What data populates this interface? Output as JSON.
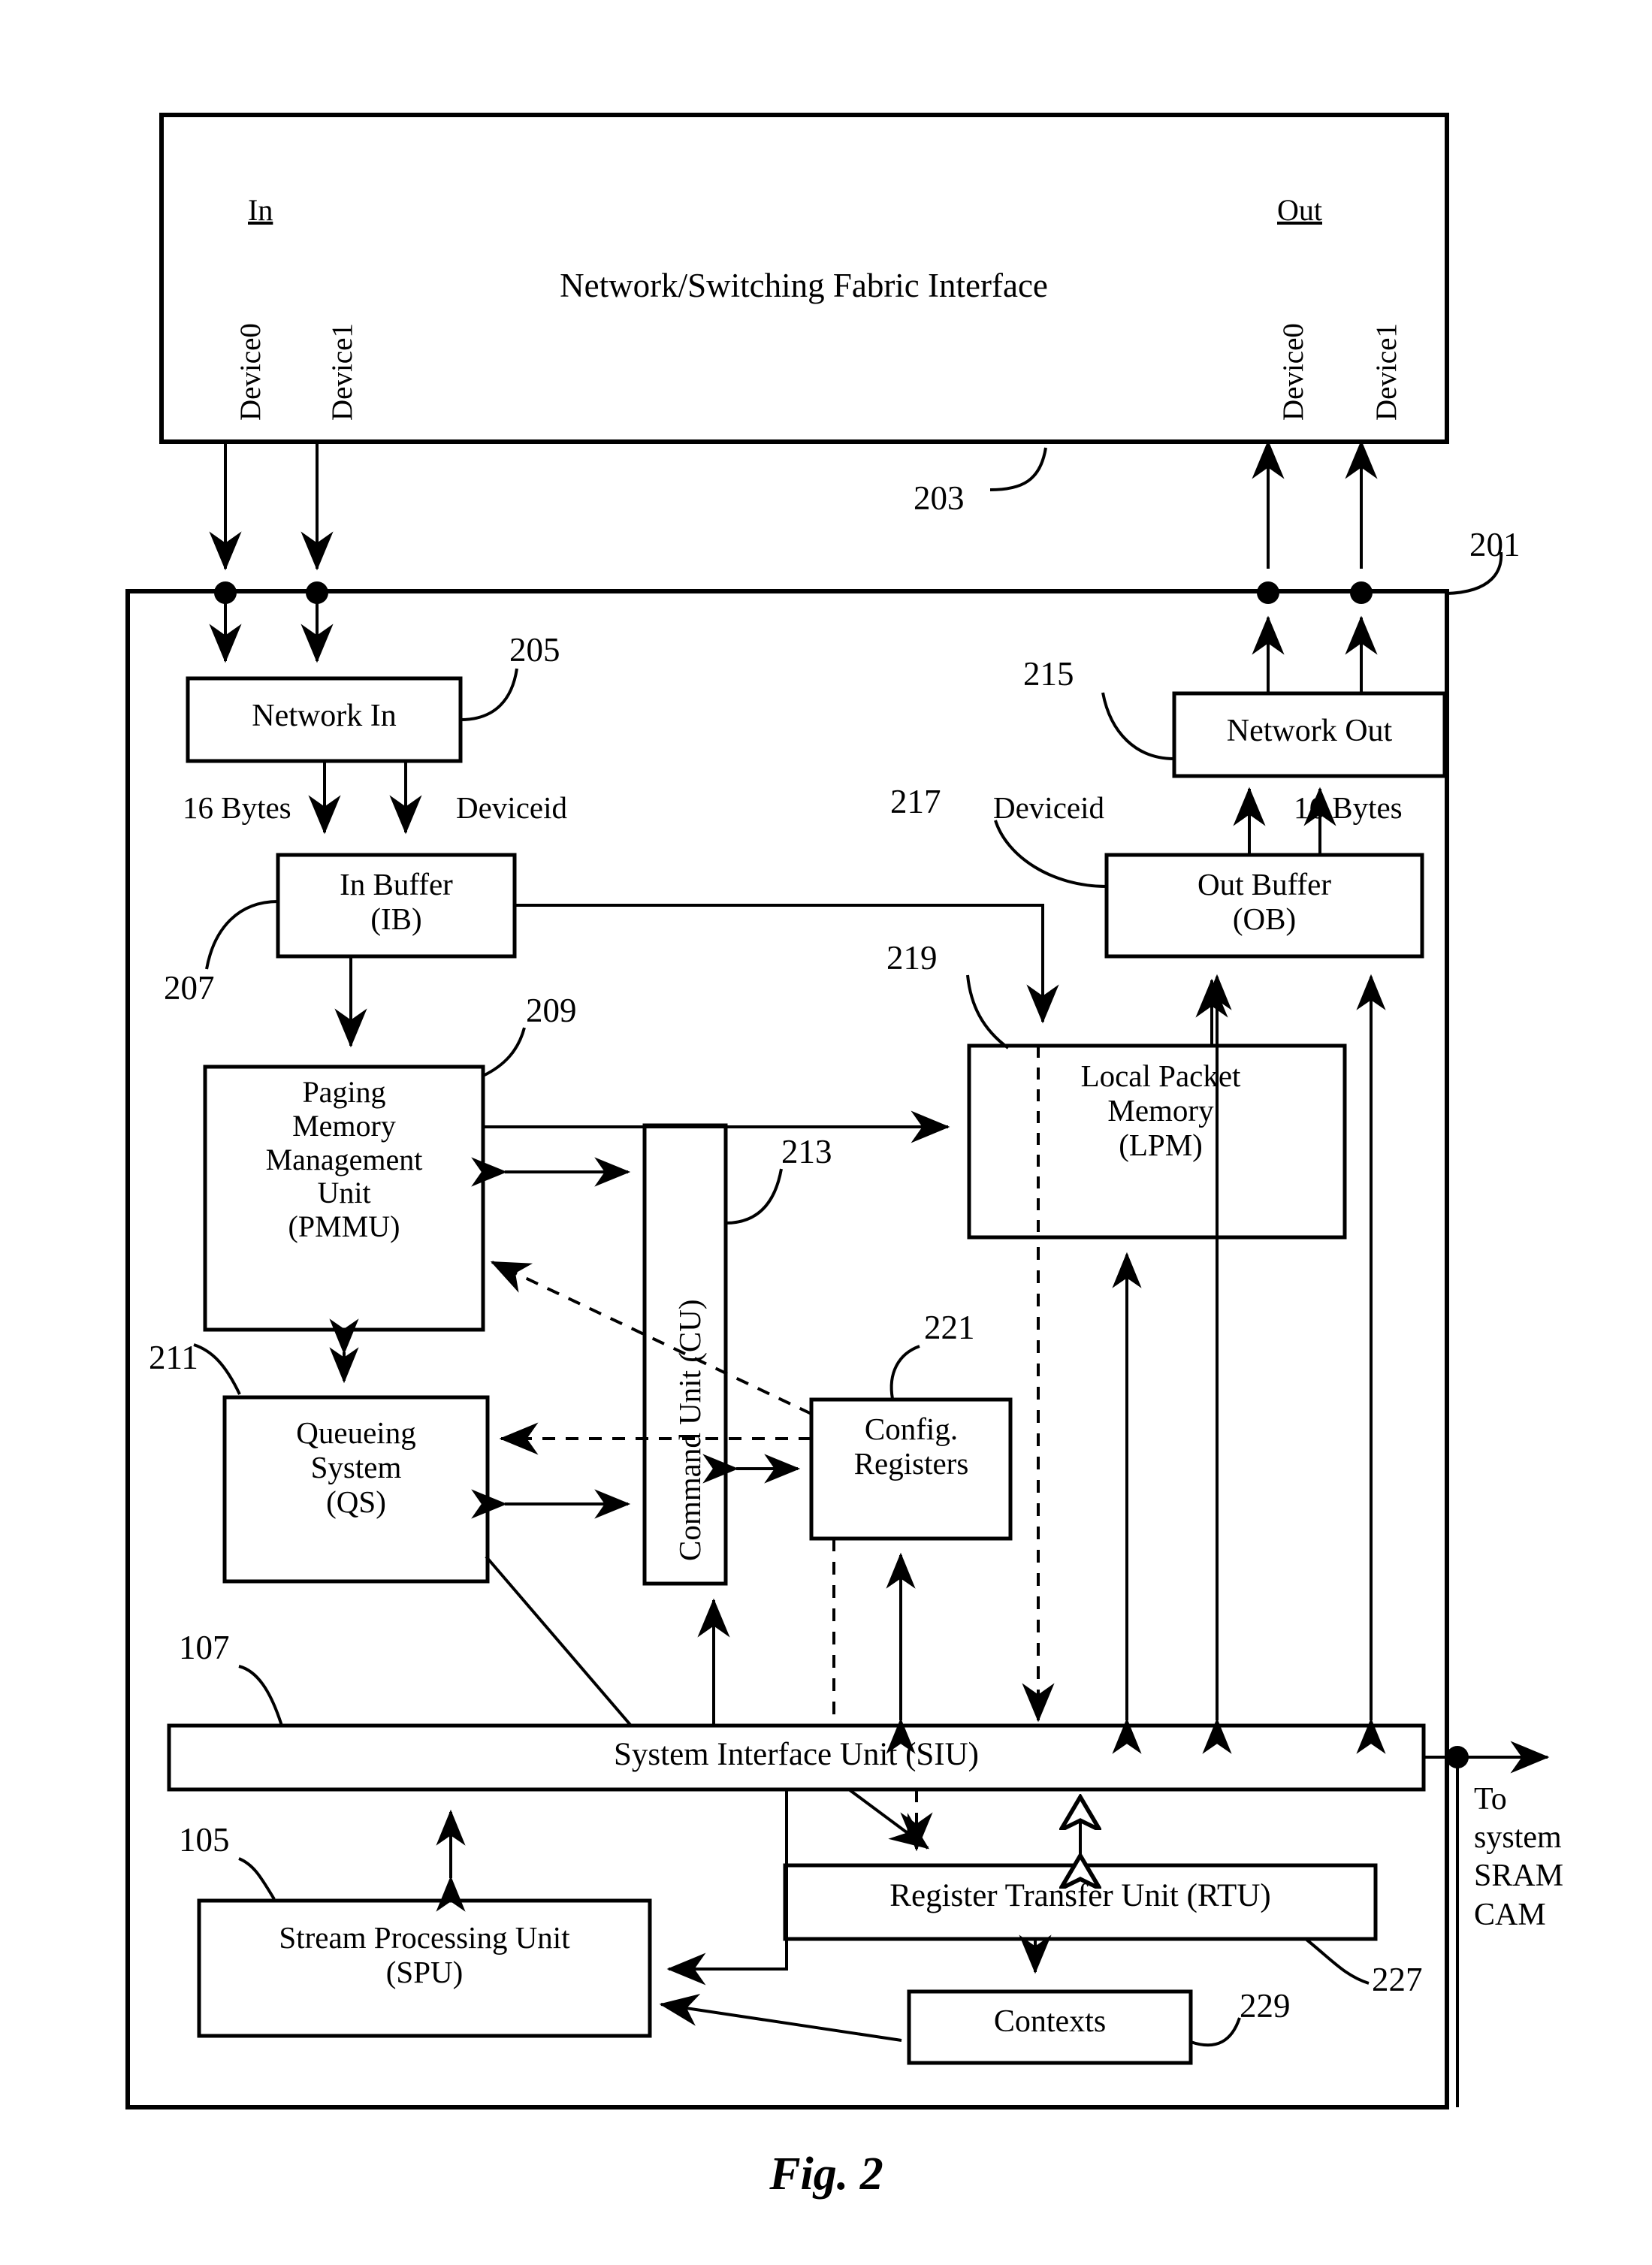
{
  "figure": {
    "caption": "Fig. 2",
    "outer_interface_box": {
      "title": "Network/Switching Fabric Interface",
      "in_group_label": "In",
      "out_group_label": "Out",
      "in_ports": [
        "Device0",
        "Device1"
      ],
      "out_ports": [
        "Device0",
        "Device1"
      ],
      "reference": "203"
    },
    "chip_box": {
      "reference": "201"
    },
    "blocks": [
      {
        "id": "network_in",
        "label": "Network In",
        "reference": "205"
      },
      {
        "id": "in_buffer",
        "label": "In Buffer\n(IB)",
        "reference": "207"
      },
      {
        "id": "pmmu",
        "label": "Paging\nMemory\nManagement\nUnit\n(PMMU)",
        "reference": "209"
      },
      {
        "id": "qs",
        "label": "Queueing\nSystem\n(QS)",
        "reference": "211"
      },
      {
        "id": "cu",
        "label": "Command Unit (CU)",
        "reference": "213"
      },
      {
        "id": "network_out",
        "label": "Network Out",
        "reference": "215"
      },
      {
        "id": "out_buffer",
        "label": "Out Buffer\n(OB)",
        "reference": "217"
      },
      {
        "id": "lpm",
        "label": "Local Packet\nMemory\n(LPM)",
        "reference": "219"
      },
      {
        "id": "config_regs",
        "label": "Config.\nRegisters",
        "reference": "221"
      },
      {
        "id": "siu",
        "label": "System Interface Unit (SIU)",
        "reference": "107"
      },
      {
        "id": "spu",
        "label": "Stream Processing Unit\n(SPU)",
        "reference": "105"
      },
      {
        "id": "rtu",
        "label": "Register Transfer Unit (RTU)",
        "reference": "227"
      },
      {
        "id": "contexts",
        "label": "Contexts",
        "reference": "229"
      }
    ],
    "edge_labels": {
      "in_bytes": "16 Bytes",
      "in_deviceid": "Deviceid",
      "out_deviceid": "Deviceid",
      "out_bytes": "16 Bytes"
    },
    "external_label": "To\nsystem\nSRAM\nCAM",
    "reference_numbers": [
      "201",
      "203",
      "205",
      "207",
      "209",
      "211",
      "213",
      "215",
      "217",
      "219",
      "221",
      "107",
      "105",
      "227",
      "229"
    ]
  }
}
